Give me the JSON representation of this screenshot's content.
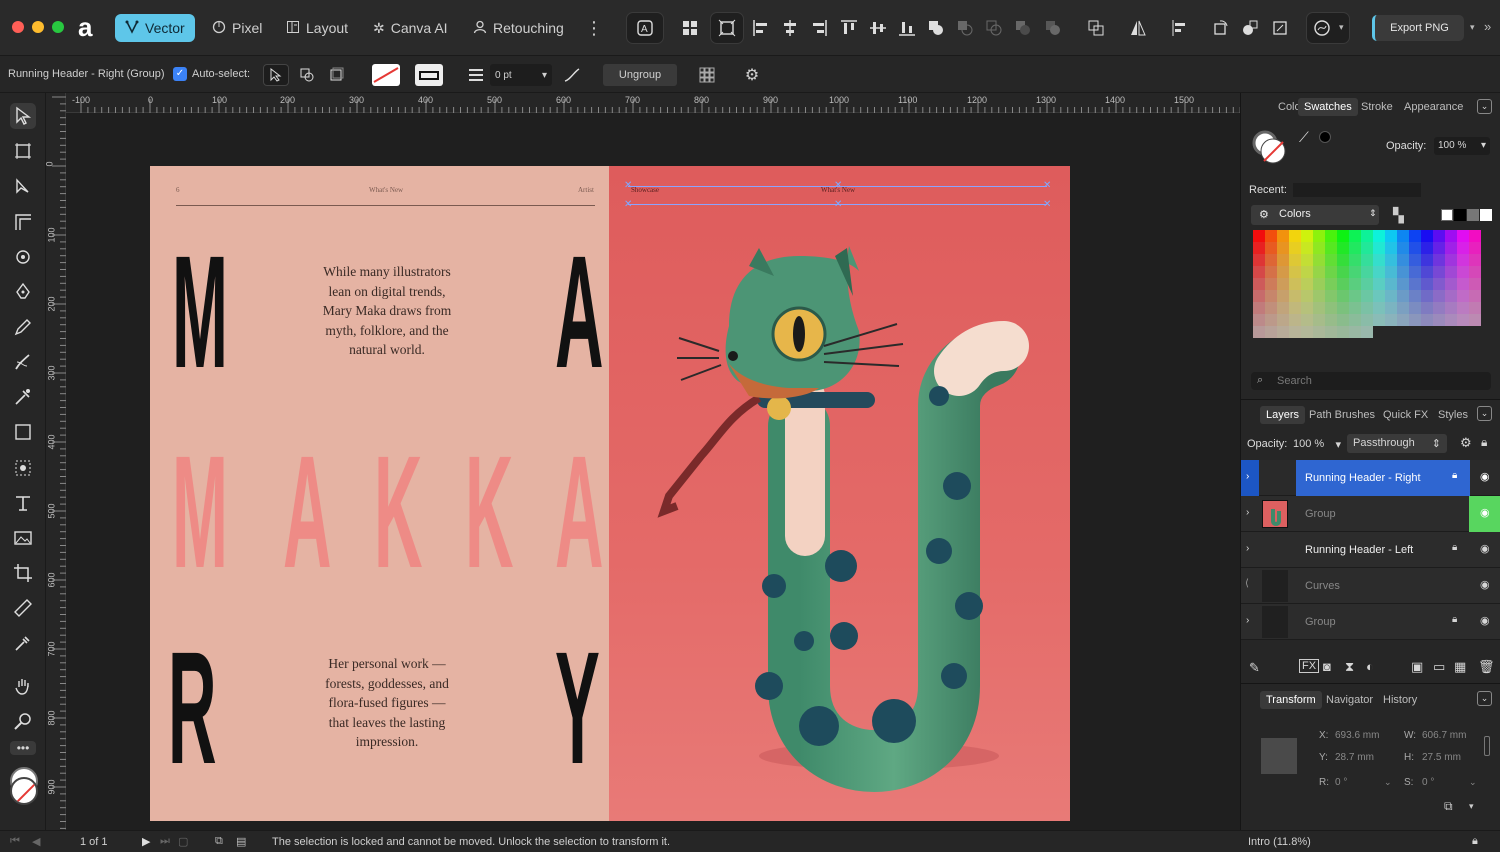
{
  "personas": [
    {
      "label": "Vector",
      "active": true
    },
    {
      "label": "Pixel",
      "active": false
    },
    {
      "label": "Layout",
      "active": false
    },
    {
      "label": "Canva AI",
      "active": false
    },
    {
      "label": "Retouching",
      "active": false
    }
  ],
  "toolbar": {
    "export_label": "Export PNG"
  },
  "context": {
    "selection_label": "Running Header - Right (Group)",
    "auto_select_label": "Auto-select:",
    "stroke_width": "0 pt",
    "ungroup_label": "Ungroup"
  },
  "ruler": {
    "unit": "mm",
    "h_ticks": [
      "-100",
      "0",
      "100",
      "200",
      "300",
      "400",
      "500",
      "600",
      "700",
      "800",
      "900",
      "1000",
      "1100",
      "1200",
      "1300",
      "1400",
      "1500"
    ],
    "v_ticks": [
      "0",
      "100",
      "200",
      "300",
      "400",
      "500",
      "600",
      "700",
      "800",
      "900"
    ]
  },
  "page_left": {
    "header_num": "6",
    "header_center": "What's New",
    "header_right": "Artist",
    "para1": "While many illustrators lean on digital trends, Mary Maka draws from myth, folklore, and the natural world.",
    "para2": "Her personal work — forests, goddesses, and flora-fused figures — that leaves the lasting impression.",
    "letters_top": [
      "M",
      "A"
    ],
    "letters_mid": [
      "M",
      "A",
      "K",
      "K",
      "A"
    ],
    "letters_bot": [
      "R",
      "Y"
    ]
  },
  "page_right": {
    "header_left": "Showcase",
    "header_center": "What's New"
  },
  "panel_tabs": [
    "Color",
    "Swatches",
    "Stroke",
    "Appearance"
  ],
  "swatches": {
    "opacity_label": "Opacity:",
    "opacity_value": "100 %",
    "recent_label": "Recent:",
    "palette_name": "Colors",
    "search_placeholder": "Search"
  },
  "layer_tabs": [
    "Layers",
    "Path Brushes",
    "Quick FX",
    "Styles"
  ],
  "layers_panel": {
    "opacity_label": "Opacity:",
    "opacity_value": "100 %",
    "blend_mode": "Passthrough",
    "items": [
      {
        "name": "Running Header - Right",
        "selected": true,
        "locked": true,
        "visible": true
      },
      {
        "name": "Group",
        "selected": false,
        "locked": false,
        "visible": true
      },
      {
        "name": "Running Header - Left",
        "selected": false,
        "locked": true,
        "visible": true
      },
      {
        "name": "Curves",
        "selected": false,
        "locked": false,
        "visible": true
      },
      {
        "name": "Group",
        "selected": false,
        "locked": true,
        "visible": true
      }
    ]
  },
  "transform_tabs": [
    "Transform",
    "Navigator",
    "History"
  ],
  "transform": {
    "x": "693.6 mm",
    "y": "28.7 mm",
    "w": "606.7 mm",
    "h": "27.5 mm",
    "r": "0 °",
    "s": "0 °",
    "x_label": "X:",
    "y_label": "Y:",
    "w_label": "W:",
    "h_label": "H:",
    "r_label": "R:",
    "s_label": "S:"
  },
  "status": {
    "page": "1 of 1",
    "message": "The selection is locked and cannot be moved. Unlock the selection to transform it.",
    "doc": "Intro (11.8%)"
  }
}
